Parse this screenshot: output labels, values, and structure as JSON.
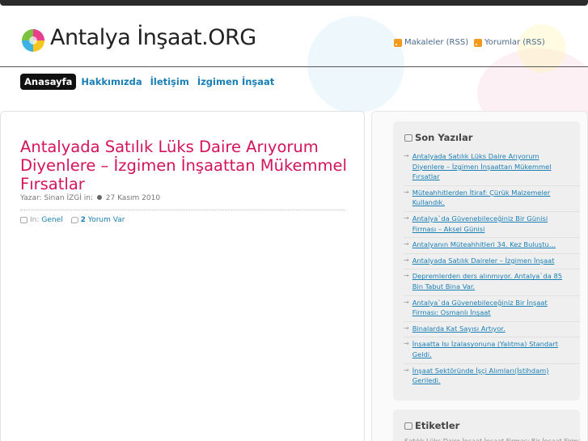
{
  "header": {
    "site_title": "Antalya İnşaat.ORG",
    "rss_articles": "Makaleler (RSS)",
    "rss_comments": "Yorumlar (RSS)"
  },
  "nav": {
    "items": [
      {
        "label": "Anasayfa",
        "active": true
      },
      {
        "label": "Hakkımızda",
        "active": false
      },
      {
        "label": "İletişim",
        "active": false
      },
      {
        "label": "İzgimen İnşaat",
        "active": false
      }
    ]
  },
  "post": {
    "title": "Antalyada Satılık Lüks Daire Arıyorum Diyenlere – İzgimen İnşaattan Mükemmel Fırsatlar",
    "author_prefix": "Yazar: Sinan İZGİ in:",
    "date": "27 Kasım 2010",
    "category_prefix": "In:",
    "category": "Genel",
    "comment_count": "2",
    "comment_label": "Yorum Var"
  },
  "sidebar": {
    "recent_title": "Son Yazılar",
    "recent": [
      "Antalyada Satılık Lüks Daire Arıyorum Diyenlere – İzgimen İnşaattan Mükemmel Fırsatlar",
      "Müteahhitlerden İtiraf: Çürük Malzemeler Kullandık.",
      "Antalya`da Güvenebileceğiniz Bir Günisi Firması – Aksel Günisi",
      "Antalyanın Müteahhitleri 34. Kez Buluştu…",
      "Antalyada Satılık Daireler – İzgimen İnşaat",
      "Depremlerden ders alınmıyor. Antalya`da 85 Bin Tabut Bina Var.",
      "Antalya`da Güvenebileceğiniz Bir İnşaat Firması: Osmanlı İnşaat",
      "Binalarda Kat Sayısı Artıyor.",
      "İnşaatta Isı İzalasyonuna (Yalıtma) Standart Geldi.",
      "İnşaat Sektöründe İşçi Alımları(İstihdam) Geriledi."
    ],
    "tags_title": "Etiketler",
    "tags_cut": "Satılık Lüks Daire İnşaat İnşaat Firması Bir İnşaat Firması"
  },
  "colors": {
    "title_accent": "#d4145a",
    "link": "#1a7fb5",
    "topbar": "#2b2b2b"
  }
}
